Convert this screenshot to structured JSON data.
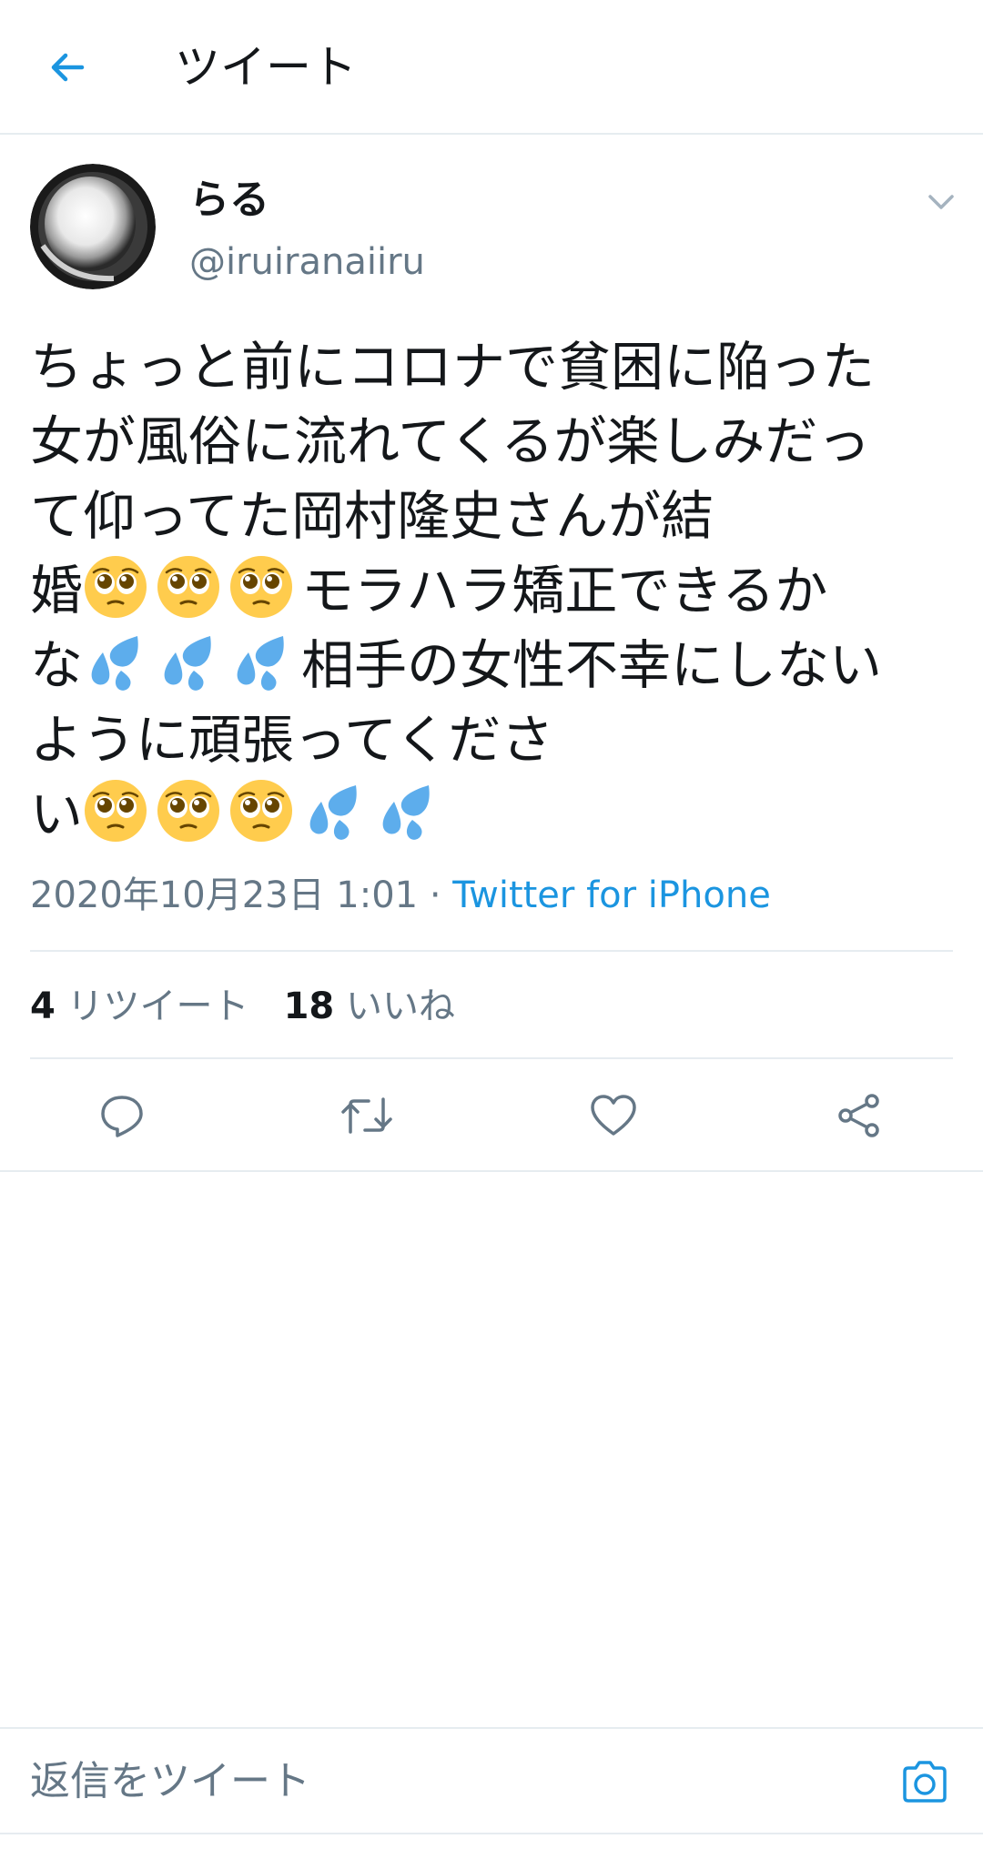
{
  "header": {
    "title": "ツイート",
    "back_icon": "arrow-left-icon"
  },
  "tweet": {
    "display_name": "らる",
    "handle": "@iruiranaiiru",
    "lines": [
      "ちょっと前にコロナで貧困に陥った",
      "女が風俗に流れてくるが楽しみだっ",
      "て仰ってた岡村隆史さんが結",
      {
        "before": "婚",
        "emoji": [
          "pleading-face",
          "pleading-face",
          "pleading-face"
        ],
        "after": "モラハラ矯正できるか"
      },
      {
        "before": "な",
        "emoji": [
          "sweat-droplets",
          "sweat-droplets",
          "sweat-droplets"
        ],
        "after": "相手の女性不幸にしない"
      },
      "ように頑張ってくださ",
      {
        "before": "い",
        "emoji": [
          "pleading-face",
          "pleading-face",
          "pleading-face",
          "sweat-droplets",
          "sweat-droplets"
        ],
        "after": ""
      }
    ],
    "timestamp": "2020年10月23日 1:01",
    "separator": " · ",
    "source": "Twitter for iPhone"
  },
  "stats": {
    "retweets_count": "4",
    "retweets_label": "リツイート",
    "likes_count": "18",
    "likes_label": "いいね"
  },
  "actions": [
    "reply-icon",
    "retweet-icon",
    "like-icon",
    "share-icon"
  ],
  "reply_bar": {
    "placeholder": "返信をツイート",
    "camera_icon": "camera-icon"
  },
  "colors": {
    "accent": "#1b95e0",
    "secondary_text": "#657786",
    "primary_text": "#14171a",
    "divider": "#e6ecf0"
  }
}
